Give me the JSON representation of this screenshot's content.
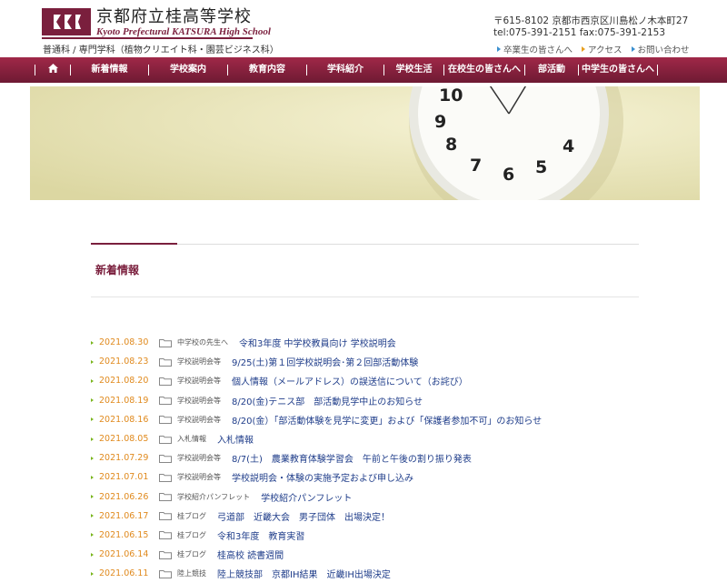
{
  "header": {
    "school_name": "京都府立桂高等学校",
    "school_name_en": "Kyoto Prefectural KATSURA High School",
    "subtitle": "普通科 / 専門学科（植物クリエイト科・園芸ビジネス科）",
    "address": "〒615-8102 京都市西京区川島松ノ木本町27",
    "contact": "tel:075-391-2151 fax:075-391-2153",
    "links": [
      {
        "label": "卒業生の皆さんへ",
        "color": "#3a8fcf"
      },
      {
        "label": "アクセス",
        "color": "#e8a020"
      },
      {
        "label": "お問い合わせ",
        "color": "#3a8fcf"
      }
    ]
  },
  "nav": {
    "home_icon": "home-icon",
    "items": [
      "新着情報",
      "学校案内",
      "教育内容",
      "学科紹介",
      "学校生活",
      "在校生の皆さんへ",
      "部活動",
      "中学生の皆さんへ"
    ]
  },
  "section": {
    "title": "新着情報"
  },
  "news": [
    {
      "date": "2021.08.30",
      "category": "中学校の先生へ",
      "title": "令和3年度 中学校教員向け 学校説明会"
    },
    {
      "date": "2021.08.23",
      "category": "学校説明会等",
      "title": "9/25(土)第１回学校説明会･第２回部活動体験"
    },
    {
      "date": "2021.08.20",
      "category": "学校説明会等",
      "title": "個人情報（メールアドレス）の誤送信について（お詫び）"
    },
    {
      "date": "2021.08.19",
      "category": "学校説明会等",
      "title": "8/20(金)テニス部　部活動見学中止のお知らせ"
    },
    {
      "date": "2021.08.16",
      "category": "学校説明会等",
      "title": "8/20(金）「部活動体験を見学に変更」および「保護者参加不可」のお知らせ"
    },
    {
      "date": "2021.08.05",
      "category": "入札情報",
      "title": "入札情報"
    },
    {
      "date": "2021.07.29",
      "category": "学校説明会等",
      "title": "8/7(土)　農業教育体験学習会　午前と午後の割り振り発表"
    },
    {
      "date": "2021.07.01",
      "category": "学校説明会等",
      "title": "学校説明会・体験の実施予定および申し込み"
    },
    {
      "date": "2021.06.26",
      "category": "学校紹介パンフレット",
      "title": "学校紹介パンフレット"
    },
    {
      "date": "2021.06.17",
      "category": "桂ブログ",
      "title": "弓道部　近畿大会　男子団体　出場決定！"
    },
    {
      "date": "2021.06.15",
      "category": "桂ブログ",
      "title": "令和3年度　教育実習"
    },
    {
      "date": "2021.06.14",
      "category": "桂ブログ",
      "title": "桂高校 読書週間"
    },
    {
      "date": "2021.06.11",
      "category": "陸上競技",
      "title": "陸上競技部　京都IH結果　近畿IH出場決定"
    }
  ],
  "colors": {
    "brand": "#7a1f3d",
    "date": "#e08a1e",
    "link": "#1f3d8a",
    "bullet": "#7ab51d"
  }
}
